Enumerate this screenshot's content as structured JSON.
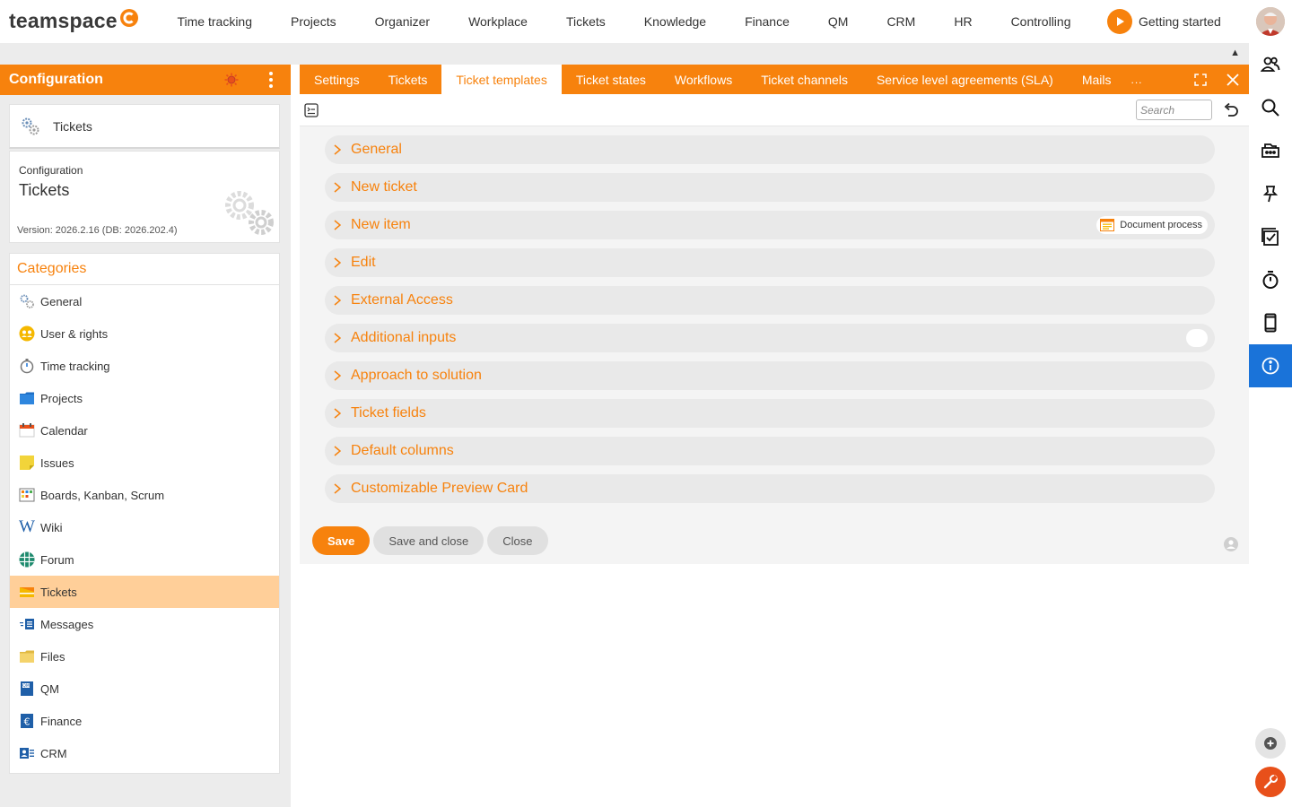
{
  "app": {
    "logo_text": "teamspace",
    "nav": [
      "Time tracking",
      "Projects",
      "Organizer",
      "Workplace",
      "Tickets",
      "Knowledge",
      "Finance",
      "QM",
      "CRM",
      "HR",
      "Controlling"
    ],
    "getting_started": "Getting started"
  },
  "sidebar": {
    "title": "Configuration",
    "module_card": "Tickets",
    "config_label": "Configuration",
    "config_title": "Tickets",
    "version": "Version: 2026.2.16 (DB: 2026.202.4)",
    "categories_title": "Categories",
    "categories": [
      {
        "label": "General",
        "icon": "gears-icon"
      },
      {
        "label": "User & rights",
        "icon": "users-icon"
      },
      {
        "label": "Time tracking",
        "icon": "stopwatch-icon"
      },
      {
        "label": "Projects",
        "icon": "folder-icon"
      },
      {
        "label": "Calendar",
        "icon": "calendar-icon"
      },
      {
        "label": "Issues",
        "icon": "sticky-note-icon"
      },
      {
        "label": "Boards, Kanban, Scrum",
        "icon": "board-icon"
      },
      {
        "label": "Wiki",
        "icon": "wiki-icon"
      },
      {
        "label": "Forum",
        "icon": "forum-icon"
      },
      {
        "label": "Tickets",
        "icon": "ticket-icon",
        "active": true
      },
      {
        "label": "Messages",
        "icon": "messages-icon"
      },
      {
        "label": "Files",
        "icon": "files-icon"
      },
      {
        "label": "QM",
        "icon": "qm-icon"
      },
      {
        "label": "Finance",
        "icon": "euro-icon"
      },
      {
        "label": "CRM",
        "icon": "crm-icon"
      }
    ]
  },
  "main": {
    "tabs": [
      {
        "label": "Settings"
      },
      {
        "label": "Tickets"
      },
      {
        "label": "Ticket templates",
        "active": true
      },
      {
        "label": "Ticket states"
      },
      {
        "label": "Workflows"
      },
      {
        "label": "Ticket channels"
      },
      {
        "label": "Service level agreements (SLA)"
      },
      {
        "label": "Mails"
      },
      {
        "label": "..."
      }
    ],
    "search_placeholder": "Search",
    "sections": [
      {
        "label": "General"
      },
      {
        "label": "New ticket"
      },
      {
        "label": "New item",
        "badge": "Document process"
      },
      {
        "label": "Edit"
      },
      {
        "label": "External Access"
      },
      {
        "label": "Additional inputs",
        "toggle": true
      },
      {
        "label": "Approach to solution"
      },
      {
        "label": "Ticket fields"
      },
      {
        "label": "Default columns"
      },
      {
        "label": "Customizable Preview Card"
      }
    ],
    "buttons": {
      "save": "Save",
      "save_close": "Save and close",
      "close": "Close"
    }
  },
  "colors": {
    "accent": "#f7820d",
    "active_category": "#ffcf99",
    "rail_active": "#1a73d9",
    "tools_fab": "#e8501a"
  },
  "rail_icons": [
    "people-icon",
    "search-icon",
    "inbox-icon",
    "pin-icon",
    "tasks-icon",
    "timer-icon",
    "mobile-icon",
    "info-icon"
  ]
}
